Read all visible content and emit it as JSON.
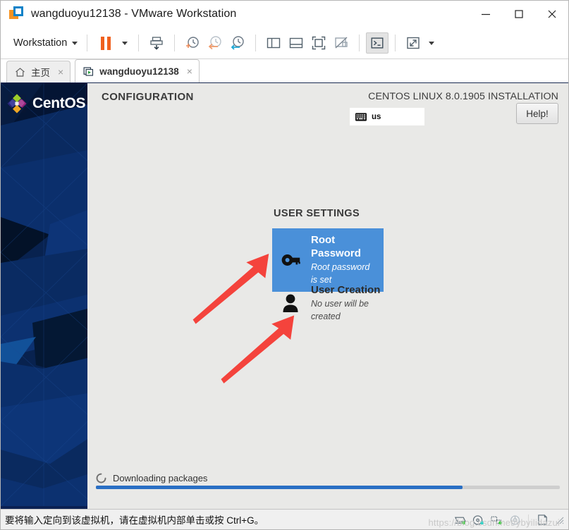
{
  "window": {
    "title": "wangduoyu12138 - VMware Workstation",
    "app_icon": "vmware-logo-icon",
    "minimize_label": "Minimize",
    "maximize_label": "Maximize",
    "close_label": "Close"
  },
  "toolbar": {
    "menu_label": "Workstation",
    "items": [
      {
        "name": "pause-vm-button",
        "label": "Pause"
      },
      {
        "name": "pause-dropdown-button",
        "label": "Pause options"
      },
      {
        "name": "manage-snapshot-button",
        "label": "Manage Snapshots"
      },
      {
        "name": "take-snapshot-button",
        "label": "Take Snapshot"
      },
      {
        "name": "revert-snapshot-button",
        "label": "Revert to Snapshot"
      },
      {
        "name": "snapshot-manager-button",
        "label": "Snapshot Manager"
      },
      {
        "name": "show-library-button",
        "label": "Show or Hide Library"
      },
      {
        "name": "show-thumbnail-button",
        "label": "Show or Hide Thumbnail Bar"
      },
      {
        "name": "full-screen-button",
        "label": "Enter Full Screen"
      },
      {
        "name": "unity-mode-button",
        "label": "Unity Mode"
      },
      {
        "name": "console-view-button",
        "label": "Console View"
      },
      {
        "name": "stretch-guest-button",
        "label": "Stretch Guest"
      },
      {
        "name": "stretch-dropdown-button",
        "label": "Stretch options"
      }
    ]
  },
  "tabs": [
    {
      "label": "主页",
      "icon": "home-icon",
      "active": false,
      "close": "×"
    },
    {
      "label": "wangduoyu12138",
      "icon": "vm-play-icon",
      "active": true,
      "close": "×"
    }
  ],
  "installer": {
    "brand": "CentOS",
    "brand_icon": "centos-logo-icon",
    "header_left": "CONFIGURATION",
    "header_right": "CENTOS LINUX 8.0.1905 INSTALLATION",
    "keyboard_layout": "us",
    "keyboard_icon": "keyboard-icon",
    "help_label": "Help!",
    "section_title": "USER SETTINGS",
    "spokes": [
      {
        "id": "root-password",
        "icon": "key-icon",
        "title": "Root Password",
        "subtitle": "Root password is set",
        "selected": true,
        "accent": "#4a90d9"
      },
      {
        "id": "user-creation",
        "icon": "person-icon",
        "title": "User Creation",
        "subtitle": "No user will be created",
        "selected": false,
        "accent": "#000000"
      }
    ],
    "progress": {
      "icon": "spinner-icon",
      "label": "Downloading packages",
      "percent": 79,
      "fill_color": "#2a6fc4",
      "track_color": "#cecece"
    },
    "annotations": [
      {
        "name": "arrow-to-root-password",
        "color": "#f4433c"
      },
      {
        "name": "arrow-to-user-creation",
        "color": "#f4433c"
      }
    ]
  },
  "statusbar": {
    "message": "要将输入定向到该虚拟机，请在虚拟机内部单击或按 Ctrl+G。",
    "devices": [
      {
        "name": "hard-disk-device-icon",
        "dot": "#3fcf3f"
      },
      {
        "name": "cd-dvd-device-icon",
        "dot": "#2ad4c8"
      },
      {
        "name": "network-adapter-device-icon",
        "dot": "#3fcf3f"
      },
      {
        "name": "usb-device-icon",
        "dot": ""
      },
      {
        "name": "printer-device-icon",
        "dot": ""
      }
    ],
    "resize_grip": "resize-grip-icon"
  },
  "watermark": {
    "text": "https://blog.csdn.net/ybyilidazui"
  }
}
